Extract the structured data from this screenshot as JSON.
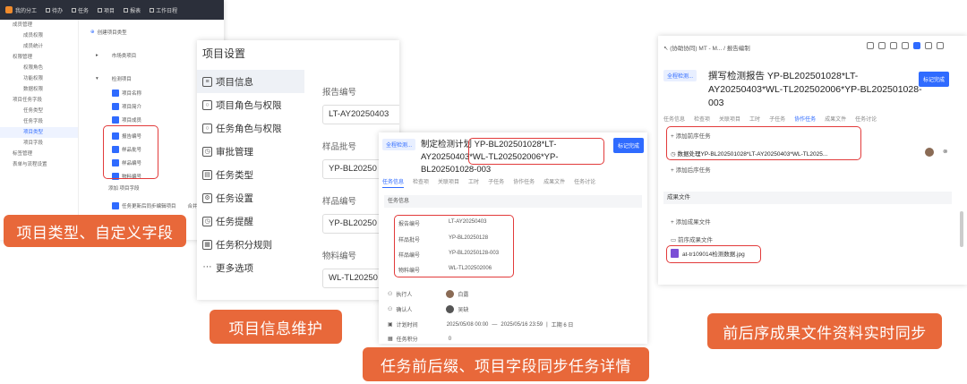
{
  "p1": {
    "topbar": {
      "app": "我的分工",
      "items": [
        "待办",
        "任务",
        "项目",
        "报表",
        "工作日程"
      ]
    },
    "sidebar": [
      "成员管理",
      "成员权限",
      "成员统计",
      "权限管理",
      "权限角色",
      "功能权限",
      "数据权限",
      "项目任务字段",
      "任务类型",
      "任务字段",
      "项目类型",
      "项目字段",
      "标签管理",
      "表单与流程设置"
    ],
    "create_btn": "创建项目类型",
    "type1": "市场类项目",
    "type2": "检测项目",
    "fields": [
      "项目名称",
      "项目简介",
      "项目成员",
      "报告编号",
      "样品批号",
      "样品编号",
      "物料编号"
    ],
    "add_field": "添加 项目字段",
    "footer_row": "任务更新后同步编辑项目",
    "footer_right": "合并同"
  },
  "caption1": "项目类型、自定义字段",
  "p2": {
    "title": "项目设置",
    "menu": [
      "项目信息",
      "项目角色与权限",
      "任务角色与权限",
      "审批管理",
      "任务类型",
      "任务设置",
      "任务提醒",
      "任务积分规则",
      "更多选项"
    ],
    "fields": [
      {
        "label": "报告编号",
        "value": "LT-AY20250403"
      },
      {
        "label": "样品批号",
        "value": "YP-BL20250"
      },
      {
        "label": "样品编号",
        "value": "YP-BL20250"
      },
      {
        "label": "物料编号",
        "value": "WL-TL20250"
      }
    ]
  },
  "caption2": "项目信息维护",
  "p3": {
    "pill": "全程检测...",
    "title": "制定检测计划 YP-BL202501028*LT-AY20250403*WL-TL202502006*YP-BL202501028-003",
    "done": "标记完成",
    "tabs": [
      "任务信息",
      "检查项",
      "关联项目",
      "工时",
      "子任务",
      "协作任务",
      "成果文件",
      "任务讨论"
    ],
    "section": "任务信息",
    "kv": [
      {
        "k": "报告编号",
        "v": "LT-AY20250403"
      },
      {
        "k": "样品批号",
        "v": "YP-BL20250128"
      },
      {
        "k": "样品编号",
        "v": "YP-BL20250128-003"
      },
      {
        "k": "物料编号",
        "v": "WL-TL202502006"
      }
    ],
    "executor_label": "执行人",
    "executor": "白露",
    "confirmer_label": "确认人",
    "confirmer": "吴缺",
    "time_label": "计划时间",
    "start": "2025/05/08 00:00",
    "end": "2025/05/16 23:59",
    "workday": "工期 6 日",
    "score_label": "任务积分",
    "score": "0"
  },
  "caption3": "任务前后缀、项目字段同步任务详情",
  "p4": {
    "breadcrumb": "(协助协同) MT - M... / 报告编制",
    "pill": "全程检测...",
    "title": "撰写检测报告 YP-BL202501028*LT-AY20250403*WL-TL202502006*YP-BL202501028-003",
    "done": "标记完成",
    "tabs": [
      "任务信息",
      "检查项",
      "关联项目",
      "工时",
      "子任务",
      "协作任务",
      "成果文件",
      "任务讨论"
    ],
    "add_pre": "+ 添加前序任务",
    "pre_task": "数据处理YP-BL202501028*LT-AY20250403*WL-TL2025...",
    "add_post": "+ 添加后序任务",
    "section": "成果文件",
    "add_file": "+ 添加成果文件",
    "pre_file": "前序成果文件",
    "file": "at-tr109014检测数据.jpg"
  },
  "caption4": "前后序成果文件资料实时同步"
}
